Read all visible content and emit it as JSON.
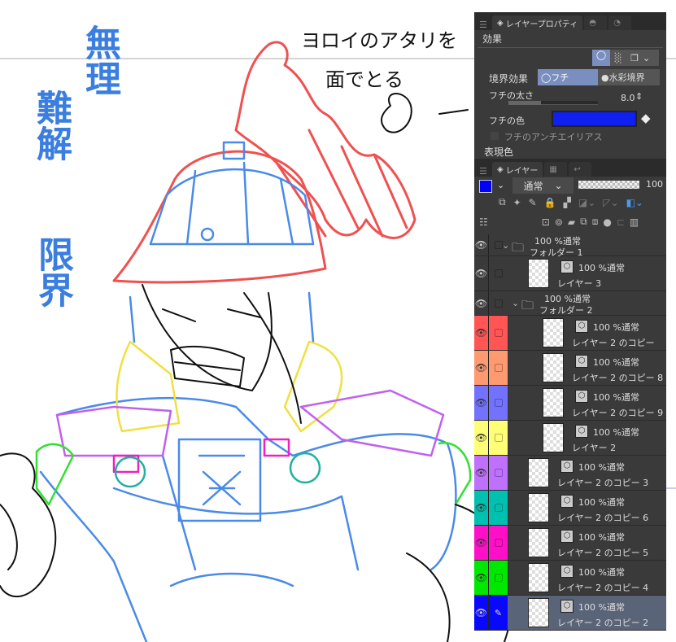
{
  "canvas": {
    "handwriting_vertical": [
      "無理",
      "難解",
      "限界"
    ],
    "note_line1": "ヨロイのアタリを",
    "note_line2": "面でとる"
  },
  "properties_panel": {
    "tabs": [
      {
        "label": "レイヤープロパティ",
        "icon": "layer-property-icon"
      },
      {
        "label": "",
        "icon": "tone-icon"
      },
      {
        "label": "",
        "icon": "search-icon"
      }
    ],
    "section_effect": "効果",
    "border_effect_label": "境界効果",
    "border_options": [
      "フチ",
      "水彩境界"
    ],
    "selected_border": "フチ",
    "edge_width_label": "フチの太さ",
    "edge_width_value": "8.0",
    "edge_color_label": "フチの色",
    "edge_color": "#1020f0",
    "antialias_label": "フチのアンチエイリアス",
    "section_expression": "表現色"
  },
  "layer_panel": {
    "tabs": [
      {
        "label": "レイヤー",
        "icon": "layers-icon"
      },
      {
        "label": "",
        "icon": "animation-icon"
      },
      {
        "label": "",
        "icon": "undo-history-icon"
      }
    ],
    "main_color": "#0000ff",
    "blend_mode": "通常",
    "opacity": "100",
    "layers": [
      {
        "type": "folder",
        "mode": "100 %通常",
        "name": "フォルダー 1",
        "indent": 0,
        "color": null
      },
      {
        "type": "layer",
        "mode": "100 %通常",
        "name": "レイヤー 3",
        "indent": 1,
        "color": null
      },
      {
        "type": "folder",
        "mode": "100 %通常",
        "name": "フォルダー 2",
        "indent": 1,
        "color": null
      },
      {
        "type": "layer",
        "mode": "100 %通常",
        "name": "レイヤー 2 のコピー",
        "indent": 2,
        "color": "#ff5555"
      },
      {
        "type": "layer",
        "mode": "100 %通常",
        "name": "レイヤー 2 のコピー 8",
        "indent": 2,
        "color": "#ff9a70"
      },
      {
        "type": "layer",
        "mode": "100 %通常",
        "name": "レイヤー 2 のコピー 9",
        "indent": 2,
        "color": "#7272ff"
      },
      {
        "type": "layer",
        "mode": "100 %通常",
        "name": "レイヤー 2",
        "indent": 2,
        "color": "#ffff77"
      },
      {
        "type": "layer",
        "mode": "100 %通常",
        "name": "レイヤー 2 のコピー 3",
        "indent": 1,
        "color": "#c070ff"
      },
      {
        "type": "layer",
        "mode": "100 %通常",
        "name": "レイヤー 2 のコピー 6",
        "indent": 1,
        "color": "#00c0b0"
      },
      {
        "type": "layer",
        "mode": "100 %通常",
        "name": "レイヤー 2 のコピー 5",
        "indent": 1,
        "color": "#ff10c8"
      },
      {
        "type": "layer",
        "mode": "100 %通常",
        "name": "レイヤー 2 のコピー 4",
        "indent": 1,
        "color": "#00e800"
      },
      {
        "type": "layer",
        "mode": "100 %通常",
        "name": "レイヤー 2 のコピー 2",
        "indent": 1,
        "color": "#0808ff",
        "selected": true
      }
    ]
  }
}
